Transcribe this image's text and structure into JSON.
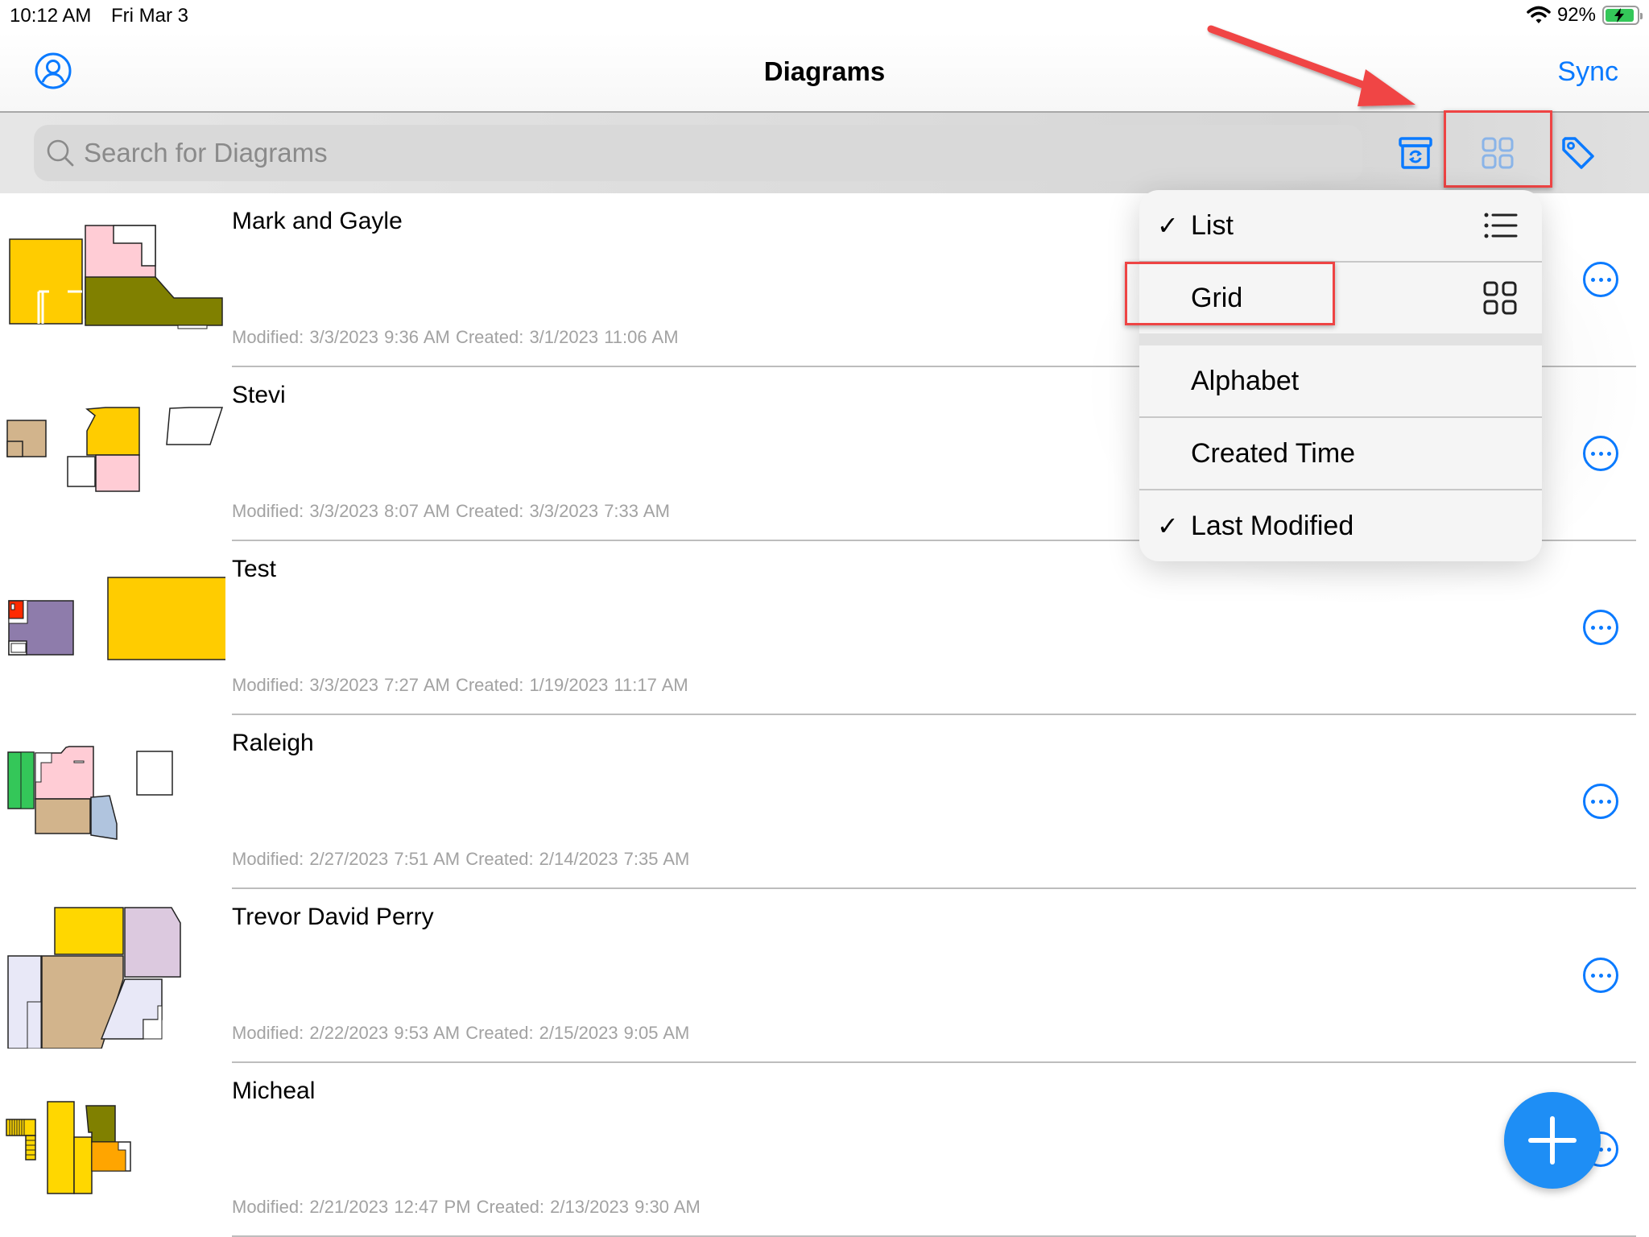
{
  "status_bar": {
    "time": "10:12 AM",
    "date": "Fri Mar 3",
    "battery_percent": "92%",
    "battery_level": 0.92,
    "charging": true,
    "wifi_icon": "wifi-icon"
  },
  "nav": {
    "title": "Diagrams",
    "sync_label": "Sync",
    "profile_icon": "person-circle-icon"
  },
  "toolbar": {
    "search_placeholder": "Search for Diagrams",
    "search_value": "",
    "icons": [
      "archive-sync-icon",
      "grid-view-icon",
      "tag-icon"
    ]
  },
  "colors": {
    "accent": "#0a7aff",
    "fab": "#1e8ef5",
    "annotation": "#ee4444",
    "meta_text": "#a2a2a2"
  },
  "menu": {
    "view_options": [
      {
        "label": "List",
        "checked": true,
        "icon": "list-icon"
      },
      {
        "label": "Grid",
        "checked": false,
        "icon": "grid-icon"
      }
    ],
    "sort_options": [
      {
        "label": "Alphabet",
        "checked": false
      },
      {
        "label": "Created Time",
        "checked": false
      },
      {
        "label": "Last Modified",
        "checked": true
      }
    ],
    "check_glyph": "✓"
  },
  "diagrams": [
    {
      "name": "Mark and Gayle",
      "meta": "Modified: 3/3/2023 9:36 AM  Created: 3/1/2023 11:06 AM"
    },
    {
      "name": "Stevi",
      "meta": "Modified: 3/3/2023 8:07 AM  Created: 3/3/2023 7:33 AM"
    },
    {
      "name": "Test",
      "meta": "Modified: 3/3/2023 7:27 AM  Created: 1/19/2023 11:17 AM"
    },
    {
      "name": "Raleigh",
      "meta": "Modified: 2/27/2023 7:51 AM  Created: 2/14/2023 7:35 AM"
    },
    {
      "name": "Trevor David Perry",
      "meta": "Modified: 2/22/2023 9:53 AM  Created: 2/15/2023 9:05 AM"
    },
    {
      "name": "Micheal",
      "meta": "Modified: 2/21/2023 12:47 PM  Created: 2/13/2023 9:30 AM"
    }
  ],
  "fab": {
    "icon": "plus-icon"
  }
}
